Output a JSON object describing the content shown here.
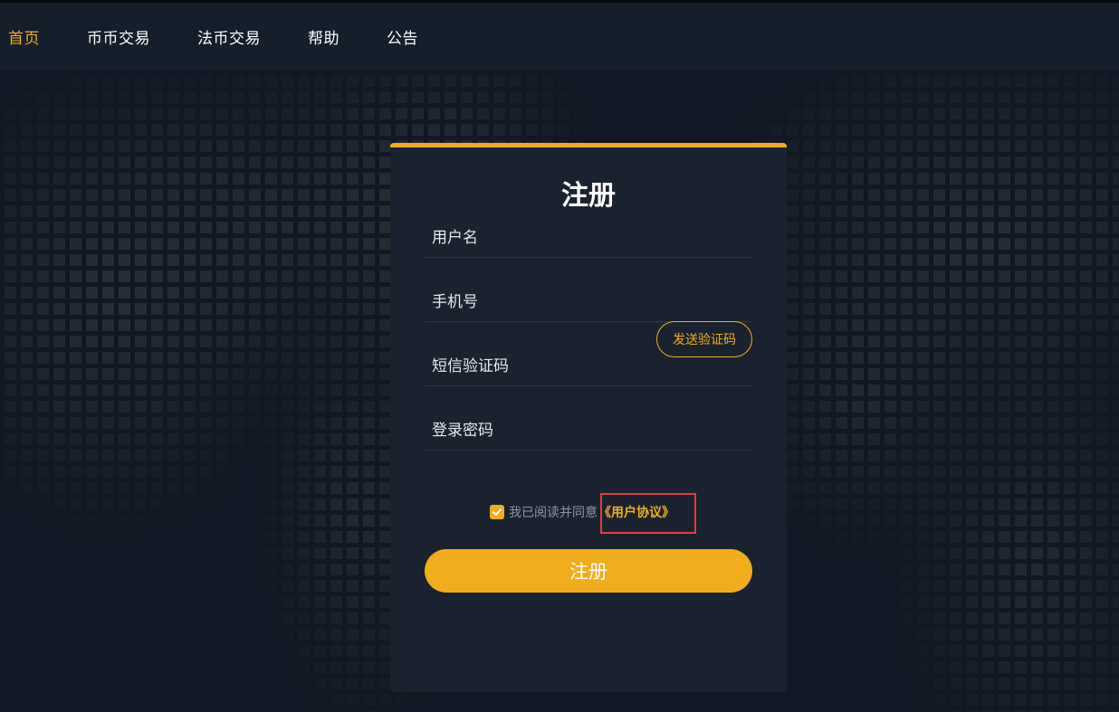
{
  "nav": {
    "items": [
      {
        "label": "首页",
        "active": true
      },
      {
        "label": "币币交易",
        "active": false
      },
      {
        "label": "法币交易",
        "active": false
      },
      {
        "label": "帮助",
        "active": false
      },
      {
        "label": "公告",
        "active": false
      }
    ]
  },
  "register": {
    "title": "注册",
    "username_placeholder": "用户名",
    "phone_placeholder": "手机号",
    "sms_code_placeholder": "短信验证码",
    "password_placeholder": "登录密码",
    "send_code_label": "发送验证码",
    "agree_text": "我已阅读并同意",
    "agreement_link": "《用户协议》",
    "agree_checked": true,
    "submit_label": "注册"
  },
  "colors": {
    "accent": "#f0ad20",
    "background": "#0f1824",
    "card": "#1a2230",
    "highlight": "#e43b3b"
  }
}
